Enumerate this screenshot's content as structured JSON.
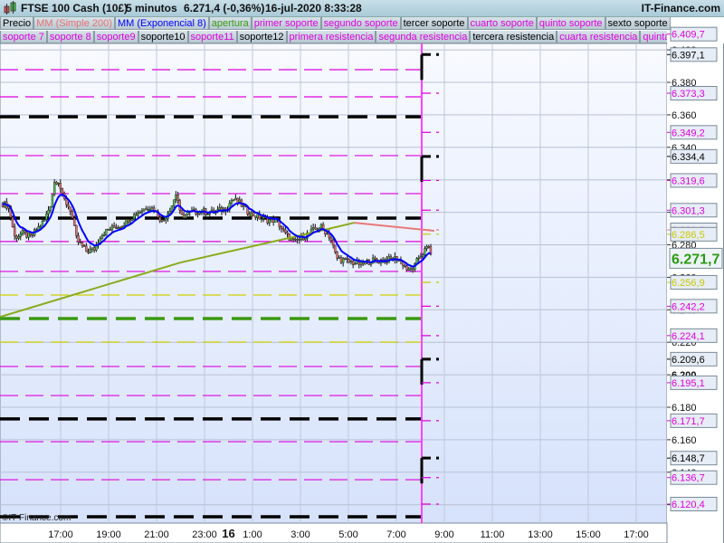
{
  "header": {
    "instrument": "FTSE 100 Cash (10£)",
    "timeframe": "5 minutos",
    "last": "6.271,4 (-0,36%)",
    "datetime": "16-jul-2020 8:33:28",
    "brand": "IT-Finance.com",
    "icon": "candlestick-icon"
  },
  "legend_row1": [
    {
      "label": "Precio",
      "color": "#000000"
    },
    {
      "label": "MM (Simple 200)",
      "color": "#e87070"
    },
    {
      "label": "MM (Exponencial 8)",
      "color": "#0000ff"
    },
    {
      "label": "apertura",
      "color": "#3a9a10"
    },
    {
      "label": "primer soporte",
      "color": "#e000e0"
    },
    {
      "label": "segundo soporte",
      "color": "#e000e0"
    },
    {
      "label": "tercer soporte",
      "color": "#000000"
    },
    {
      "label": "cuarto soporte",
      "color": "#e000e0"
    },
    {
      "label": "quinto soporte",
      "color": "#e000e0"
    },
    {
      "label": "sexto soporte",
      "color": "#000000"
    }
  ],
  "legend_row2": [
    {
      "label": "soporte 7",
      "color": "#e000e0"
    },
    {
      "label": "soporte 8",
      "color": "#e000e0"
    },
    {
      "label": "soporte9",
      "color": "#e000e0"
    },
    {
      "label": "soporte10",
      "color": "#000000"
    },
    {
      "label": "soporte11",
      "color": "#e000e0"
    },
    {
      "label": "soporte12",
      "color": "#000000"
    },
    {
      "label": "primera resistencia",
      "color": "#e000e0"
    },
    {
      "label": "segunda resistencia",
      "color": "#e000e0"
    },
    {
      "label": "tercera resistencia",
      "color": "#000000"
    },
    {
      "label": "cuarta resistencia",
      "color": "#e000e0"
    },
    {
      "label": "quinta resistencia",
      "color": "#e000e0"
    }
  ],
  "watermark": "©IT-Finance.com",
  "chart_data": {
    "type": "candlestick",
    "title": "FTSE 100 Cash (10£) 5 minutos",
    "ylim": [
      6113,
      6415
    ],
    "y_ticks": [
      "6.400",
      "6.380",
      "6.360",
      "6.340",
      "6.320",
      "6.300",
      "6.280",
      "6.260",
      "6.240",
      "6.220",
      "6.200",
      "6.180",
      "6.160",
      "6.140",
      "6.120"
    ],
    "y_bold_tick": "6.200",
    "x_ticks": [
      {
        "label": "17:00",
        "t": "15 17:00"
      },
      {
        "label": "19:00",
        "t": "15 19:00"
      },
      {
        "label": "21:00",
        "t": "15 21:00"
      },
      {
        "label": "23:00",
        "t": "15 23:00"
      },
      {
        "label": "16",
        "t": "16 00:00",
        "bold": true
      },
      {
        "label": "1:00",
        "t": "16 01:00"
      },
      {
        "label": "3:00",
        "t": "16 03:00"
      },
      {
        "label": "5:00",
        "t": "16 05:00"
      },
      {
        "label": "7:00",
        "t": "16 07:00"
      },
      {
        "label": "9:00",
        "t": "16 09:00"
      },
      {
        "label": "11:00",
        "t": "16 11:00"
      },
      {
        "label": "13:00",
        "t": "16 13:00"
      },
      {
        "label": "15:00",
        "t": "16 15:00"
      },
      {
        "label": "17:00",
        "t": "16 17:00"
      }
    ],
    "price_path": [
      [
        "15 14:35",
        6305.3
      ],
      [
        "15 14:50",
        6303.7
      ],
      [
        "15 15:05",
        6284.7
      ],
      [
        "15 15:25",
        6287.0
      ],
      [
        "15 15:45",
        6284.7
      ],
      [
        "15 16:00",
        6289.2
      ],
      [
        "15 16:20",
        6295.3
      ],
      [
        "15 16:35",
        6305.3
      ],
      [
        "15 16:45",
        6319.3
      ],
      [
        "15 16:55",
        6319.3
      ],
      [
        "15 17:05",
        6309.2
      ],
      [
        "15 17:25",
        6301.4
      ],
      [
        "15 17:40",
        6283.1
      ],
      [
        "15 18:05",
        6275.8
      ],
      [
        "15 18:25",
        6277.5
      ],
      [
        "15 18:40",
        6285.8
      ],
      [
        "15 18:55",
        6288.6
      ],
      [
        "15 19:10",
        6290.3
      ],
      [
        "15 19:35",
        6292.5
      ],
      [
        "15 19:55",
        6297.0
      ],
      [
        "15 20:20",
        6300.9
      ],
      [
        "15 20:40",
        6303.7
      ],
      [
        "15 20:55",
        6301.4
      ],
      [
        "15 21:15",
        6294.0
      ],
      [
        "15 21:40",
        6305.3
      ],
      [
        "15 21:50",
        6312.6
      ],
      [
        "15 22:00",
        6297.0
      ],
      [
        "15 22:25",
        6299.8
      ],
      [
        "15 22:45",
        6300.9
      ],
      [
        "15 23:20",
        6299.8
      ],
      [
        "15 23:55",
        6302.6
      ],
      [
        "16 00:10",
        6308.1
      ],
      [
        "16 00:30",
        6305.3
      ],
      [
        "16 00:50",
        6299.8
      ],
      [
        "16 01:15",
        6297.0
      ],
      [
        "16 01:35",
        6295.3
      ],
      [
        "16 02:00",
        6295.3
      ],
      [
        "16 02:20",
        6287.0
      ],
      [
        "16 02:45",
        6281.4
      ],
      [
        "16 03:05",
        6284.7
      ],
      [
        "16 03:30",
        6288.6
      ],
      [
        "16 03:50",
        6291.4
      ],
      [
        "16 04:15",
        6284.7
      ],
      [
        "16 04:30",
        6271.9
      ],
      [
        "16 04:50",
        6270.3
      ],
      [
        "16 05:10",
        6269.1
      ],
      [
        "16 05:35",
        6268.0
      ],
      [
        "16 05:55",
        6270.3
      ],
      [
        "16 06:20",
        6270.3
      ],
      [
        "16 06:40",
        6270.8
      ],
      [
        "16 07:00",
        6271.9
      ],
      [
        "16 07:15",
        6269.1
      ],
      [
        "16 07:30",
        6263.6
      ],
      [
        "16 07:45",
        6266.4
      ],
      [
        "16 07:55",
        6271.9
      ],
      [
        "16 08:05",
        6274.7
      ],
      [
        "16 08:15",
        6277.5
      ],
      [
        "16 08:20",
        6279.2
      ],
      [
        "16 08:30",
        6272.5
      ]
    ],
    "sma200": [
      {
        "t": "15 14:30",
        "v": 6235.7,
        "color": "#8aab1a"
      },
      {
        "t": "15 22:00",
        "v": 6269.1,
        "color": "#8aab1a"
      },
      {
        "t": "16 03:00",
        "v": 6285.8,
        "color": "#8aab1a"
      },
      {
        "t": "16 05:15",
        "v": 6293.6,
        "color": "#8aab1a"
      },
      {
        "t": "16 08:35",
        "v": 6288.6,
        "color": "#e87878"
      }
    ],
    "previous_levels": [
      {
        "v": 6387.8,
        "color": "#e000e0",
        "style": "thin"
      },
      {
        "v": 6371.1,
        "color": "#e000e0",
        "style": "thin"
      },
      {
        "v": 6358.8,
        "color": "#000000",
        "style": "thick"
      },
      {
        "v": 6334.9,
        "color": "#e000e0",
        "style": "thin"
      },
      {
        "v": 6311.5,
        "color": "#e000e0",
        "style": "thin"
      },
      {
        "v": 6296.4,
        "color": "#000000",
        "style": "thick"
      },
      {
        "v": 6282.0,
        "color": "#e000e0",
        "style": "thin"
      },
      {
        "v": 6263.6,
        "color": "#e000e0",
        "style": "thin"
      },
      {
        "v": 6249.1,
        "color": "#d0d000",
        "style": "thin"
      },
      {
        "v": 6234.6,
        "color": "#3a9a10",
        "style": "thick"
      },
      {
        "v": 6220.1,
        "color": "#d0d000",
        "style": "thin"
      },
      {
        "v": 6205.1,
        "color": "#e000e0",
        "style": "thin"
      },
      {
        "v": 6187.2,
        "color": "#e000e0",
        "style": "thin"
      },
      {
        "v": 6172.8,
        "color": "#000000",
        "style": "thick"
      },
      {
        "v": 6158.8,
        "color": "#e000e0",
        "style": "thin"
      },
      {
        "v": 6135.4,
        "color": "#e000e0",
        "style": "thin"
      },
      {
        "v": 6112.6,
        "color": "#000000",
        "style": "thick"
      }
    ],
    "level_labels": [
      {
        "label": "6.409,7",
        "v": 6409.7,
        "color": "#e000e0"
      },
      {
        "label": "6.397,1",
        "v": 6397.1,
        "color": "#000000"
      },
      {
        "label": "6.373,3",
        "v": 6373.3,
        "color": "#e000e0"
      },
      {
        "label": "6.349,2",
        "v": 6349.2,
        "color": "#e000e0"
      },
      {
        "label": "6.334,4",
        "v": 6334.4,
        "color": "#000000"
      },
      {
        "label": "6.319,6",
        "v": 6319.6,
        "color": "#e000e0"
      },
      {
        "label": "6.301,3",
        "v": 6301.3,
        "color": "#e000e0"
      },
      {
        "label": "6.289,2",
        "v": 6289.2,
        "color": "#e87878"
      },
      {
        "label": "6.286,5",
        "v": 6286.5,
        "color": "#c8c800"
      },
      {
        "label": "6.256,9",
        "v": 6256.9,
        "color": "#c8c800"
      },
      {
        "label": "6.242,2",
        "v": 6242.2,
        "color": "#e000e0"
      },
      {
        "label": "6.224,1",
        "v": 6224.1,
        "color": "#e000e0"
      },
      {
        "label": "6.209,6",
        "v": 6209.6,
        "color": "#000000"
      },
      {
        "label": "6.195,1",
        "v": 6195.1,
        "color": "#e000e0"
      },
      {
        "label": "6.171,7",
        "v": 6171.7,
        "color": "#e000e0"
      },
      {
        "label": "6.148,7",
        "v": 6148.7,
        "color": "#000000"
      },
      {
        "label": "6.136,7",
        "v": 6136.7,
        "color": "#e000e0"
      },
      {
        "label": "6.120,4",
        "v": 6120.4,
        "color": "#e000e0"
      }
    ],
    "current_price": {
      "label": "6.271,7",
      "v": 6271.7,
      "color": "#2a9a10"
    },
    "colors": {
      "up": "#50c050",
      "down": "#e07070",
      "ema": "#0000ff",
      "session_line": "#ff40ff"
    }
  }
}
